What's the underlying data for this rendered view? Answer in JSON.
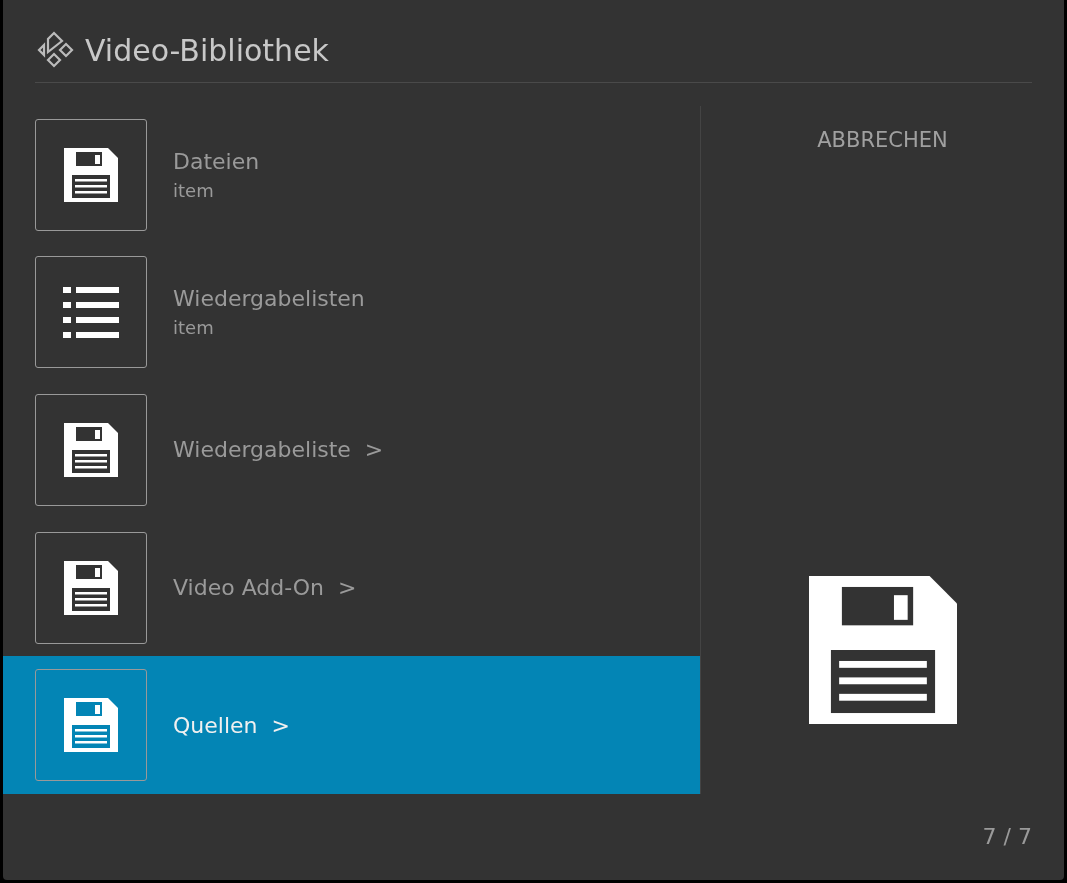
{
  "dialog": {
    "title": "Video-Bibliothek"
  },
  "items": [
    {
      "kind": "file",
      "label": "Dateien",
      "sublabel": "item",
      "selected": false
    },
    {
      "kind": "playlists",
      "label": "Wiedergabelisten",
      "sublabel": "item",
      "selected": false
    },
    {
      "kind": "file",
      "label": "Wiedergabeliste  >",
      "selected": false
    },
    {
      "kind": "file",
      "label": "Video Add-On  >",
      "selected": false
    },
    {
      "kind": "file",
      "label": "Quellen  >",
      "selected": true
    }
  ],
  "cancel_button": "ABBRECHEN",
  "counter": "7 / 7"
}
